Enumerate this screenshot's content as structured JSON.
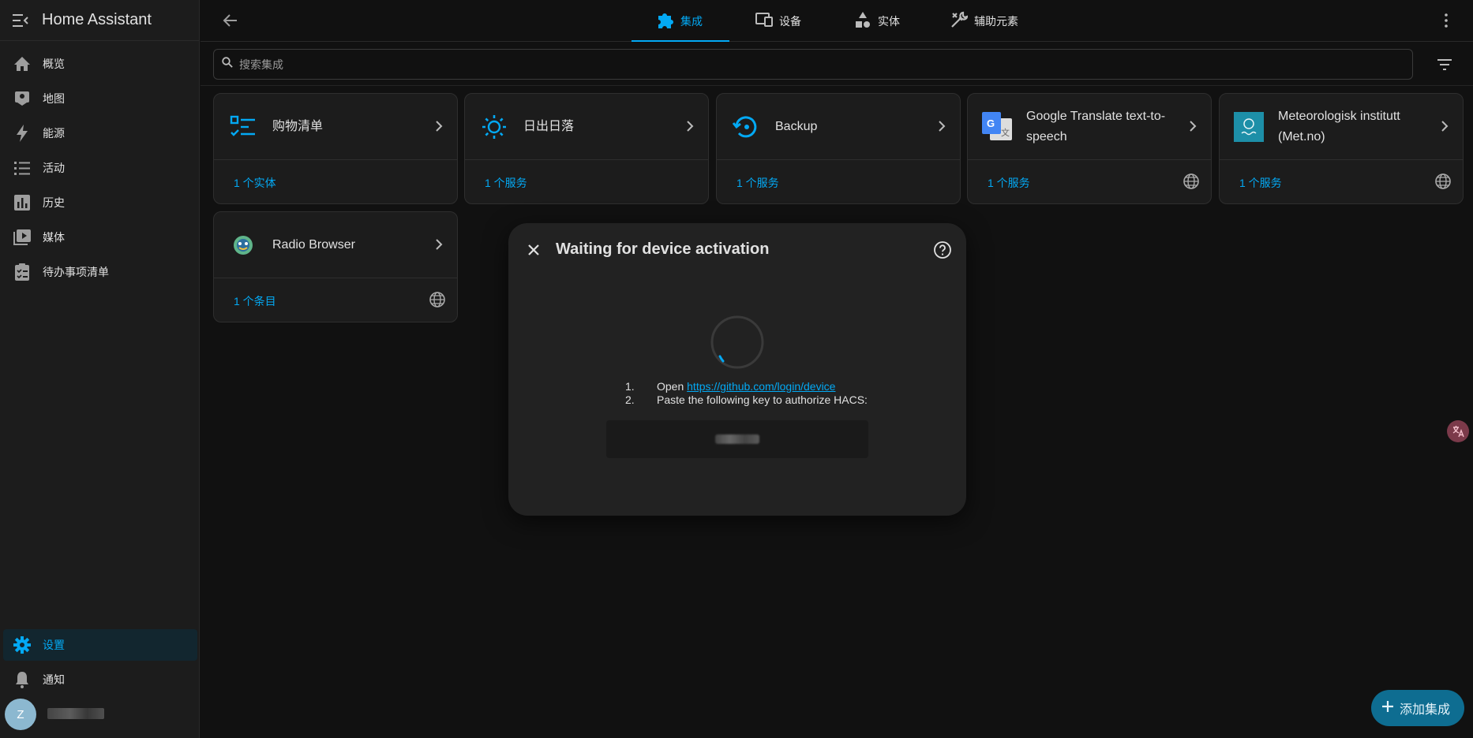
{
  "app": {
    "title": "Home Assistant"
  },
  "sidebar": {
    "items": [
      {
        "label": "概览",
        "icon": "home-icon"
      },
      {
        "label": "地图",
        "icon": "map-icon"
      },
      {
        "label": "能源",
        "icon": "lightning-icon"
      },
      {
        "label": "活动",
        "icon": "list-icon"
      },
      {
        "label": "历史",
        "icon": "chart-icon"
      },
      {
        "label": "媒体",
        "icon": "media-icon"
      },
      {
        "label": "待办事项清单",
        "icon": "clipboard-icon"
      }
    ],
    "settings_label": "设置",
    "notifications_label": "通知",
    "user_initial": "Z"
  },
  "tabs": [
    {
      "label": "集成",
      "icon": "puzzle-icon",
      "active": true
    },
    {
      "label": "设备",
      "icon": "devices-icon",
      "active": false
    },
    {
      "label": "实体",
      "icon": "shapes-icon",
      "active": false
    },
    {
      "label": "辅助元素",
      "icon": "tools-icon",
      "active": false
    }
  ],
  "search": {
    "placeholder": "搜索集成"
  },
  "cards": [
    {
      "name": "购物清单",
      "footer": "1 个实体",
      "cloud": false
    },
    {
      "name": "日出日落",
      "footer": "1 个服务",
      "cloud": false
    },
    {
      "name": "Backup",
      "footer": "1 个服务",
      "cloud": false
    },
    {
      "name": "Google Translate text-to-speech",
      "footer": "1 个服务",
      "cloud": true
    },
    {
      "name": "Meteorologisk institutt (Met.no)",
      "footer": "1 个服务",
      "cloud": true
    },
    {
      "name": "Radio Browser",
      "footer": "1 个条目",
      "cloud": true
    }
  ],
  "dialog": {
    "title": "Waiting for device activation",
    "step1_num": "1.",
    "step1_text": "Open",
    "step1_link": "https://github.com/login/device",
    "step2_num": "2.",
    "step2_text": "Paste the following key to authorize HACS:"
  },
  "fab": {
    "label": "添加集成"
  },
  "colors": {
    "accent": "#03a9f4",
    "background": "#111111",
    "card": "#1c1c1c",
    "dialog": "#222222"
  }
}
